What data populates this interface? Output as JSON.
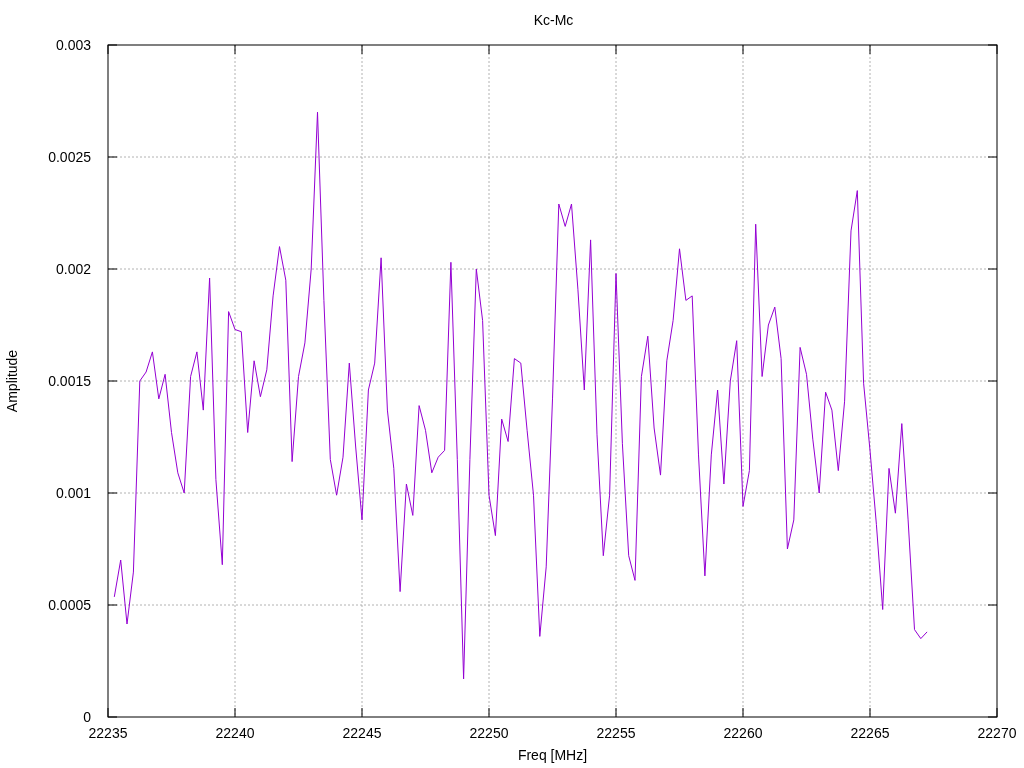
{
  "chart_data": {
    "type": "line",
    "title": "Kc-Mc",
    "xlabel": "Freq [MHz]",
    "ylabel": "Amplitude",
    "grid": true,
    "xlim": [
      22235,
      22270
    ],
    "ylim": [
      0,
      0.003
    ],
    "xticks": [
      22235,
      22240,
      22245,
      22250,
      22255,
      22260,
      22265,
      22270
    ],
    "yticks": [
      {
        "value": 0,
        "label": "0"
      },
      {
        "value": 0.0005,
        "label": "0.0005"
      },
      {
        "value": 0.001,
        "label": "0.001"
      },
      {
        "value": 0.0015,
        "label": "0.0015"
      },
      {
        "value": 0.002,
        "label": "0.002"
      },
      {
        "value": 0.0025,
        "label": "0.0025"
      },
      {
        "value": 0.003,
        "label": "0.003"
      }
    ],
    "x": [
      22235.25,
      22235.5,
      22235.75,
      22236,
      22236.25,
      22236.5,
      22236.75,
      22237,
      22237.25,
      22237.5,
      22237.75,
      22238,
      22238.25,
      22238.5,
      22238.75,
      22239,
      22239.25,
      22239.5,
      22239.75,
      22240,
      22240.25,
      22240.5,
      22240.75,
      22241,
      22241.25,
      22241.5,
      22241.75,
      22242,
      22242.25,
      22242.5,
      22242.75,
      22243,
      22243.25,
      22243.5,
      22243.75,
      22244,
      22244.25,
      22244.5,
      22244.75,
      22245,
      22245.25,
      22245.5,
      22245.75,
      22246,
      22246.25,
      22246.5,
      22246.75,
      22247,
      22247.25,
      22247.5,
      22247.75,
      22248,
      22248.25,
      22248.5,
      22248.75,
      22249,
      22249.25,
      22249.5,
      22249.75,
      22250,
      22250.25,
      22250.5,
      22250.75,
      22251,
      22251.25,
      22251.5,
      22251.75,
      22252,
      22252.25,
      22252.5,
      22252.75,
      22253,
      22253.25,
      22253.5,
      22253.75,
      22254,
      22254.25,
      22254.5,
      22254.75,
      22255,
      22255.25,
      22255.5,
      22255.75,
      22256,
      22256.25,
      22256.5,
      22256.75,
      22257,
      22257.25,
      22257.5,
      22257.75,
      22258,
      22258.25,
      22258.5,
      22258.75,
      22259,
      22259.25,
      22259.5,
      22259.75,
      22260,
      22260.25,
      22260.5,
      22260.75,
      22261,
      22261.25,
      22261.5,
      22261.75,
      22262,
      22262.25,
      22262.5,
      22262.75,
      22263,
      22263.25,
      22263.5,
      22263.75,
      22264,
      22264.25,
      22264.5,
      22264.75,
      22265,
      22265.25,
      22265.5,
      22265.75,
      22266,
      22266.25,
      22266.5,
      22266.75,
      22267,
      22267.25
    ],
    "series": [
      {
        "color": "#9400d3",
        "values": [
          0.000536,
          0.000701,
          0.000415,
          0.000647,
          0.0015,
          0.00154,
          0.00163,
          0.00142,
          0.00153,
          0.00127,
          0.00109,
          0.001,
          0.00152,
          0.00163,
          0.00137,
          0.00196,
          0.00106,
          0.00068,
          0.00181,
          0.00173,
          0.00172,
          0.00127,
          0.00159,
          0.00143,
          0.00155,
          0.00188,
          0.0021,
          0.00195,
          0.00114,
          0.00152,
          0.00167,
          0.002,
          0.0027,
          0.00186,
          0.00115,
          0.00099,
          0.00116,
          0.00158,
          0.00121,
          0.00088,
          0.00146,
          0.00158,
          0.00205,
          0.00137,
          0.00111,
          0.00056,
          0.00104,
          0.0009,
          0.00139,
          0.00128,
          0.00109,
          0.00116,
          0.00119,
          0.00203,
          0.00115,
          0.00017,
          0.00115,
          0.002,
          0.00177,
          0.00099,
          0.00081,
          0.00133,
          0.00123,
          0.0016,
          0.00158,
          0.00128,
          0.00099,
          0.00036,
          0.00067,
          0.00142,
          0.00229,
          0.00219,
          0.00229,
          0.00191,
          0.00146,
          0.00213,
          0.00126,
          0.00072,
          0.00099,
          0.00198,
          0.00122,
          0.00072,
          0.00061,
          0.00152,
          0.0017,
          0.00129,
          0.00108,
          0.00159,
          0.00177,
          0.00209,
          0.00186,
          0.00188,
          0.00117,
          0.00063,
          0.00117,
          0.00146,
          0.00104,
          0.0015,
          0.00168,
          0.00094,
          0.0011,
          0.0022,
          0.00152,
          0.00175,
          0.00183,
          0.0016,
          0.00075,
          0.00088,
          0.00165,
          0.00153,
          0.00124,
          0.001,
          0.00145,
          0.00137,
          0.0011,
          0.00141,
          0.00217,
          0.00235,
          0.00149,
          0.00119,
          0.00086,
          0.00048,
          0.00111,
          0.00091,
          0.00131,
          0.00088,
          0.00039,
          0.00035,
          0.00038
        ]
      }
    ]
  }
}
